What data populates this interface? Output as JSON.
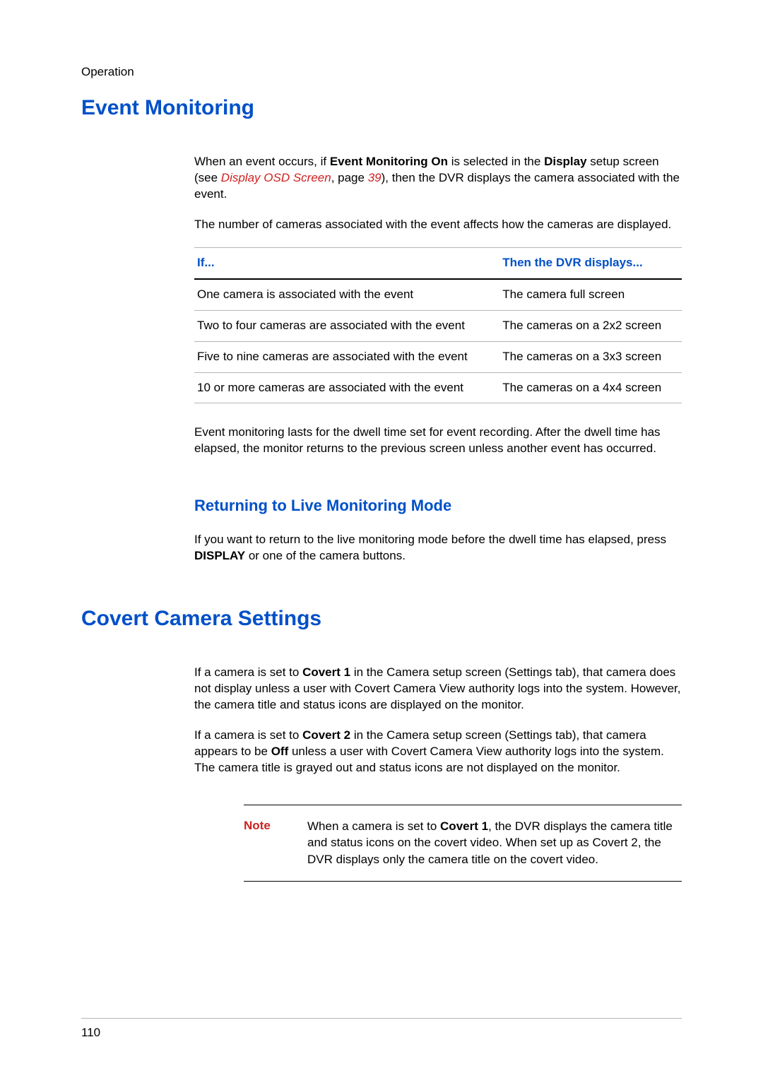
{
  "runningHead": "Operation",
  "pageNumber": "110",
  "section1": {
    "title": "Event Monitoring",
    "p1_a": "When an event occurs, if ",
    "p1_b": "Event Monitoring On",
    "p1_c": " is selected in the ",
    "p1_d": "Display",
    "p1_e": " setup screen (see ",
    "p1_ref": "Display OSD Screen",
    "p1_f": ", page ",
    "p1_page": "39",
    "p1_g": "), then the DVR displays the camera associated with the event.",
    "p2": "The number of cameras associated with the event affects how the cameras are displayed.",
    "tableHeaders": {
      "col1": "If...",
      "col2": "Then the DVR displays..."
    },
    "tableRows": [
      {
        "ifText": "One camera is associated with the event",
        "thenText": "The camera full screen"
      },
      {
        "ifText": "Two to four cameras are associated with the event",
        "thenText": "The cameras on a 2x2 screen"
      },
      {
        "ifText": "Five to nine cameras are associated with the event",
        "thenText": "The cameras on a 3x3 screen"
      },
      {
        "ifText": "10 or more cameras are associated with the event",
        "thenText": "The cameras on a 4x4 screen"
      }
    ],
    "p3": "Event monitoring lasts for the dwell time set for event recording. After the dwell time has elapsed, the monitor returns to the previous screen unless another event has occurred.",
    "sub": {
      "title": "Returning to Live Monitoring Mode",
      "p1_a": "If you want to return to the live monitoring mode before the dwell time has elapsed, press ",
      "p1_b": "DISPLAY",
      "p1_c": " or one of the camera buttons."
    }
  },
  "section2": {
    "title": "Covert Camera Settings",
    "p1_a": "If a camera is set to ",
    "p1_b": "Covert 1",
    "p1_c": " in the Camera setup screen (Settings tab), that camera does not display unless a user with Covert Camera View authority logs into the system. However, the camera title and status icons are displayed on the monitor.",
    "p2_a": "If a camera is set to ",
    "p2_b": "Covert 2",
    "p2_c": " in the Camera setup screen (Settings tab), that camera appears to be ",
    "p2_d": "Off",
    "p2_e": " unless a user with Covert Camera View authority logs into the system. The camera title is grayed out and status icons are not displayed on the monitor.",
    "note": {
      "label": "Note",
      "body_a": "When a camera is set to ",
      "body_b": "Covert 1",
      "body_c": ", the DVR displays the camera title and status icons on the covert video. When set up as Covert 2, the DVR displays only the camera title on the covert video."
    }
  }
}
